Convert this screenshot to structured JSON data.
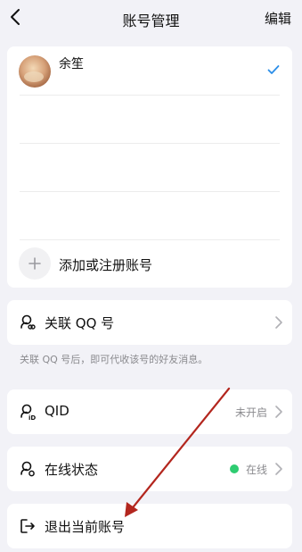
{
  "nav": {
    "title": "账号管理",
    "edit_label": "编辑"
  },
  "accounts": [
    {
      "name": "余笙",
      "selected": true
    }
  ],
  "add_account_label": "添加或注册账号",
  "link_qq": {
    "label": "关联 QQ 号",
    "hint": "关联 QQ 号后，即可代收该号的好友消息。"
  },
  "qid": {
    "label": "QID",
    "value": "未开启"
  },
  "online_status": {
    "label": "在线状态",
    "value": "在线",
    "dot_color": "#2ecc71"
  },
  "logout": {
    "label": "退出当前账号"
  },
  "annotation": {
    "arrow_color": "#b3261e"
  },
  "icons": {
    "back": "chevron-left-icon",
    "check": "check-icon",
    "add": "plus-icon",
    "link": "link-person-icon",
    "qid": "id-person-icon",
    "status": "status-person-icon",
    "logout": "logout-icon",
    "chevron": "chevron-right-icon"
  }
}
